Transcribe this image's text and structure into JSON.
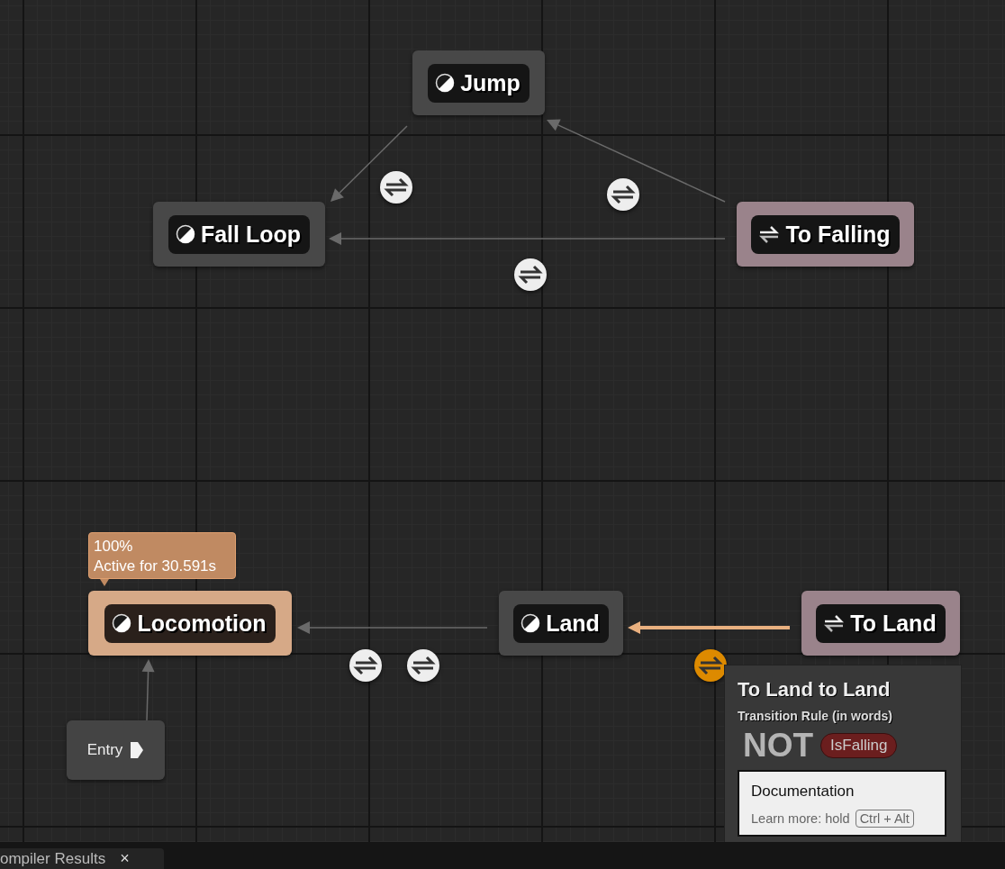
{
  "graph": {
    "states": [
      {
        "kind": "state",
        "label": "Jump",
        "active": false
      },
      {
        "kind": "state",
        "label": "Fall Loop",
        "active": false
      },
      {
        "kind": "conduit",
        "label": "To Falling",
        "active": false
      },
      {
        "kind": "state",
        "label": "Locomotion",
        "active": true
      },
      {
        "kind": "state",
        "label": "Land",
        "active": false
      },
      {
        "kind": "conduit",
        "label": "To Land",
        "active": false
      },
      {
        "kind": "entry",
        "label": "Entry",
        "active": false
      }
    ],
    "edges": [
      {
        "active": false
      },
      {
        "active": false
      },
      {
        "active": false
      },
      {
        "active": false
      },
      {
        "active": true
      },
      {
        "active": false
      }
    ],
    "transitions": [
      {
        "selected": false
      },
      {
        "selected": false
      },
      {
        "selected": false
      },
      {
        "selected": false
      },
      {
        "selected": false
      },
      {
        "selected": true
      }
    ],
    "active_badge": {
      "weight": "100%",
      "duration": "Active for 30.591s"
    }
  },
  "tooltip": {
    "title": "To Land to Land",
    "subtitle": "Transition Rule (in words)",
    "operator": "NOT",
    "variable": "IsFalling",
    "documentation": {
      "title": "Documentation",
      "hint": "Learn more: hold",
      "shortcut": "Ctrl + Alt"
    }
  },
  "bottom_tabs": [
    {
      "label": "ompiler Results",
      "close": "×"
    }
  ]
}
